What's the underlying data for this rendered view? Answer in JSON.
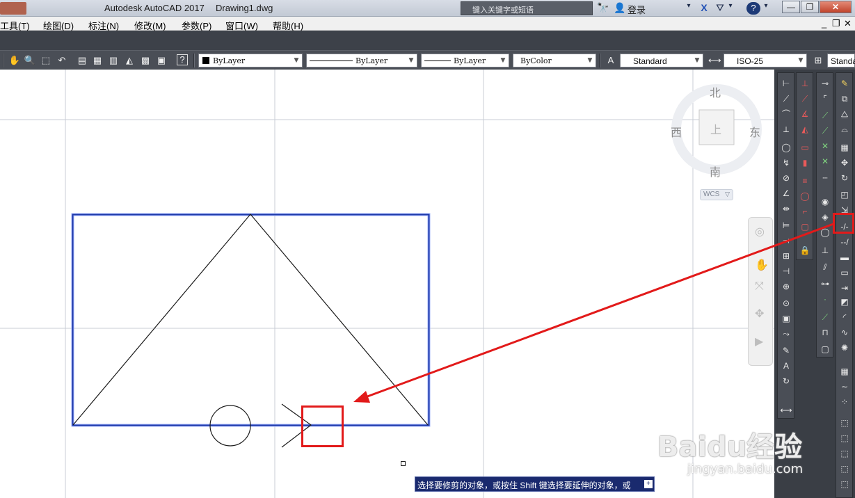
{
  "window": {
    "app_title": "Autodesk AutoCAD 2017",
    "file_name": "Drawing1.dwg",
    "search_placeholder": "键入关键字或短语",
    "login_label": "登录",
    "help_label": "?",
    "minimize": "—",
    "restore": "❐",
    "close": "✕"
  },
  "menu": {
    "items": [
      "工具(T)",
      "绘图(D)",
      "标注(N)",
      "修改(M)",
      "参数(P)",
      "窗口(W)",
      "帮助(H)"
    ],
    "doc_controls": [
      "_",
      "❐",
      "✕"
    ]
  },
  "properties_toolbar": {
    "color": "ByLayer",
    "linetype": "ByLayer",
    "lineweight": "ByLayer",
    "plot_style": "ByColor",
    "text_style": "Standard",
    "dim_style": "ISO-25",
    "table_style": "Standa"
  },
  "viewcube": {
    "north": "北",
    "south": "南",
    "east": "东",
    "west": "西",
    "face": "上",
    "wcs_label": "WCS"
  },
  "command_line": {
    "prompt": "选择要修剪的对象，或按住 Shift 键选择要延伸的对象，或",
    "expand_icon": "+"
  },
  "watermark": {
    "brand": "Baidu经验",
    "url": "jingyan.baidu.com"
  },
  "colors": {
    "selection_blue": "#1f3aa8",
    "annotation_red": "#e21a1a",
    "toolbar_dark": "#4a4e56"
  },
  "icons": {
    "draw_toolbar": [
      "line-icon",
      "construction-line-icon",
      "polyline-icon",
      "polygon-icon",
      "rectangle-icon",
      "arc-icon",
      "circle-icon",
      "revision-cloud-icon",
      "spline-icon",
      "ellipse-icon",
      "ellipse-arc-icon",
      "insert-block-icon",
      "make-block-icon",
      "point-icon",
      "hatch-icon",
      "gradient-icon",
      "region-icon",
      "table-icon",
      "mtext-icon",
      "add-selected-icon"
    ],
    "modify_toolbar": [
      "erase-icon",
      "copy-icon",
      "mirror-icon",
      "offset-icon",
      "array-icon",
      "move-icon",
      "rotate-icon",
      "scale-icon",
      "stretch-icon",
      "trim-icon",
      "extend-icon",
      "break-at-point-icon",
      "break-icon",
      "join-icon",
      "chamfer-icon",
      "fillet-icon",
      "blend-curves-icon",
      "explode-icon"
    ]
  }
}
